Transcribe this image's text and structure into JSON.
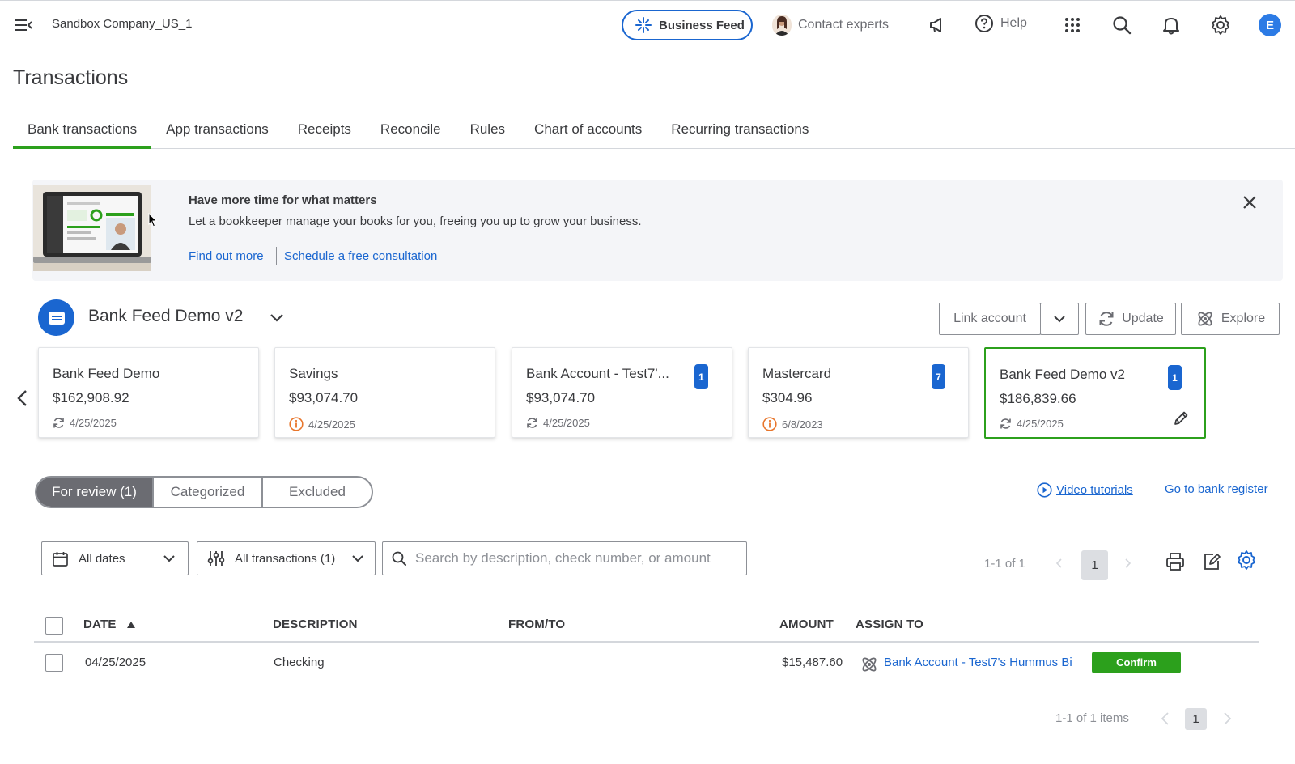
{
  "topbar": {
    "company": "Sandbox Company_US_1",
    "business_feed": "Business Feed",
    "contact_experts": "Contact experts",
    "help": "Help",
    "user_initial": "E"
  },
  "page": {
    "title": "Transactions"
  },
  "tabs": [
    {
      "label": "Bank transactions"
    },
    {
      "label": "App transactions"
    },
    {
      "label": "Receipts"
    },
    {
      "label": "Reconcile"
    },
    {
      "label": "Rules"
    },
    {
      "label": "Chart of accounts"
    },
    {
      "label": "Recurring transactions"
    }
  ],
  "banner": {
    "title": "Have more time for what matters",
    "body": "Let a bookkeeper manage your books for you, freeing you up to grow your business.",
    "link1": "Find out more",
    "link2": "Schedule a free consultation"
  },
  "account": {
    "name": "Bank Feed Demo v2",
    "link_account": "Link account",
    "update": "Update",
    "explore": "Explore"
  },
  "cards": [
    {
      "name": "Bank Feed Demo",
      "balance": "$162,908.92",
      "date": "4/25/2025"
    },
    {
      "name": "Savings",
      "balance": "$93,074.70",
      "date": "4/25/2025"
    },
    {
      "name": "Bank Account - Test7'...",
      "balance": "$93,074.70",
      "date": "4/25/2025",
      "badge": "1"
    },
    {
      "name": "Mastercard",
      "balance": "$304.96",
      "date": "6/8/2023",
      "badge": "7"
    },
    {
      "name": "Bank Feed Demo v2",
      "balance": "$186,839.66",
      "date": "4/25/2025",
      "badge": "1"
    }
  ],
  "review_tabs": {
    "for_review": "For review (1)",
    "categorized": "Categorized",
    "excluded": "Excluded"
  },
  "links": {
    "video_tutorials": "Video tutorials",
    "bank_register": "Go to bank register"
  },
  "filters": {
    "dates": "All dates",
    "transactions": "All transactions (1)",
    "search_placeholder": "Search by description, check number, or amount",
    "pager_top": "1-1 of 1",
    "page": "1"
  },
  "table": {
    "headers": {
      "date": "DATE",
      "description": "DESCRIPTION",
      "from_to": "FROM/TO",
      "amount": "AMOUNT",
      "assign_to": "ASSIGN TO"
    },
    "rows": [
      {
        "date": "04/25/2025",
        "description": "Checking",
        "from_to": "",
        "amount": "$15,487.60",
        "assign_to": "Bank Account - Test7's Hummus Bi",
        "action": "Confirm"
      }
    ]
  },
  "pager_bottom": {
    "text": "1-1 of 1 items",
    "page": "1"
  },
  "colors": {
    "accent_green": "#2ca01c",
    "link_blue": "#1a66d0",
    "text": "#393a3d"
  }
}
